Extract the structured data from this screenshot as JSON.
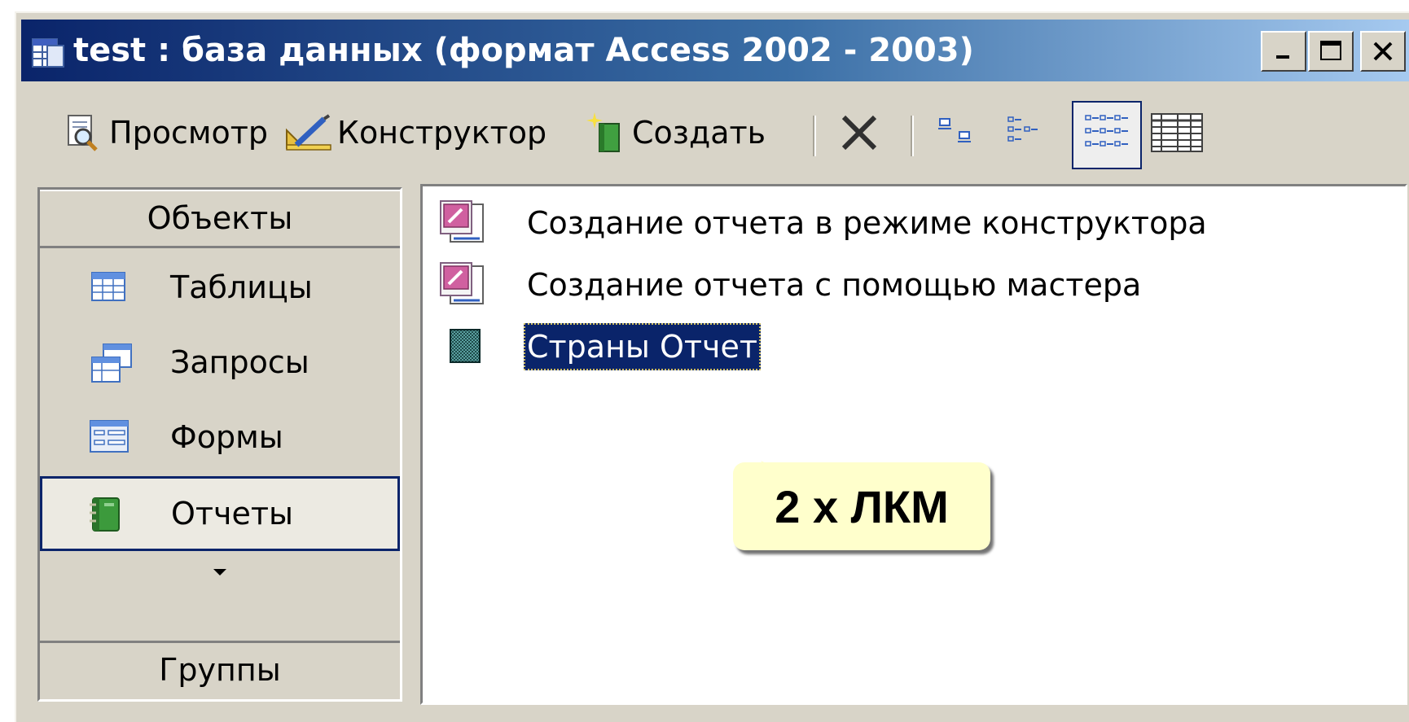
{
  "window": {
    "title": "test : база данных (формат Access 2002 - 2003)",
    "minimize_glyph": "_",
    "close_glyph": "✕"
  },
  "toolbar": {
    "preview_label": "Просмотр",
    "design_label": "Конструктор",
    "create_label": "Создать",
    "delete_icon": "x-icon",
    "view_icons": [
      "large-icons-view-icon",
      "small-icons-view-icon",
      "list-view-icon",
      "details-view-icon"
    ],
    "selected_view": "list"
  },
  "objects_bar": {
    "header": "Объекты",
    "items": [
      {
        "label": "Таблицы",
        "icon": "table-icon"
      },
      {
        "label": "Запросы",
        "icon": "query-icon"
      },
      {
        "label": "Формы",
        "icon": "form-icon"
      },
      {
        "label": "Отчеты",
        "icon": "report-icon",
        "selected": true
      }
    ],
    "groups_label": "Группы"
  },
  "list": {
    "items": [
      {
        "label": "Создание отчета в режиме конструктора",
        "icon": "design-shortcut-icon"
      },
      {
        "label": "Создание отчета с помощью мастера",
        "icon": "wizard-shortcut-icon"
      },
      {
        "label": "Страны Отчет",
        "icon": "report-icon",
        "selected": true
      }
    ]
  },
  "callout": {
    "text": "2 х ЛКМ"
  },
  "colors": {
    "title_start": "#0a246a",
    "title_end": "#a6caf0",
    "selection": "#0a246a",
    "callout_bg": "#ffffcc"
  }
}
